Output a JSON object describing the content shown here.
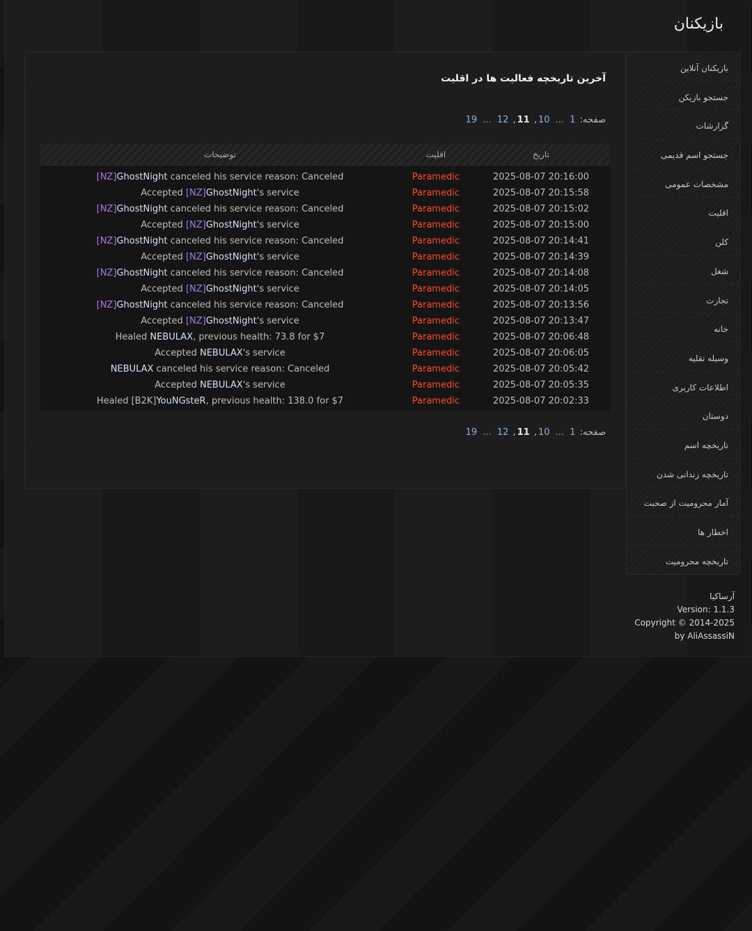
{
  "header": {
    "title": "بازیکنان"
  },
  "panel": {
    "title": "آخرین تاریخچه فعالیت ها در اقلیت"
  },
  "pagination": {
    "label": "صفحه:",
    "pages": [
      "1",
      "10",
      "11",
      "12",
      "19"
    ],
    "ellipsis": "...",
    "current": "11"
  },
  "table": {
    "headers": {
      "description": "توضیحات",
      "minority": "اقلیت",
      "date": "تاریخ"
    },
    "rows": [
      {
        "parts": [
          {
            "t": "[NZ]",
            "k": "tag"
          },
          {
            "t": "GhostNight",
            "k": "name"
          },
          {
            "t": " canceled his service reason: Canceled",
            "k": "plain"
          }
        ],
        "minority": "Paramedic",
        "date": "2025-08-07 20:16:00"
      },
      {
        "parts": [
          {
            "t": "Accepted ",
            "k": "plain"
          },
          {
            "t": "[NZ]",
            "k": "tag"
          },
          {
            "t": "GhostNight",
            "k": "name"
          },
          {
            "t": "'s service",
            "k": "plain"
          }
        ],
        "minority": "Paramedic",
        "date": "2025-08-07 20:15:58"
      },
      {
        "parts": [
          {
            "t": "[NZ]",
            "k": "tag"
          },
          {
            "t": "GhostNight",
            "k": "name"
          },
          {
            "t": " canceled his service reason: Canceled",
            "k": "plain"
          }
        ],
        "minority": "Paramedic",
        "date": "2025-08-07 20:15:02"
      },
      {
        "parts": [
          {
            "t": "Accepted ",
            "k": "plain"
          },
          {
            "t": "[NZ]",
            "k": "tag"
          },
          {
            "t": "GhostNight",
            "k": "name"
          },
          {
            "t": "'s service",
            "k": "plain"
          }
        ],
        "minority": "Paramedic",
        "date": "2025-08-07 20:15:00"
      },
      {
        "parts": [
          {
            "t": "[NZ]",
            "k": "tag"
          },
          {
            "t": "GhostNight",
            "k": "name"
          },
          {
            "t": " canceled his service reason: Canceled",
            "k": "plain"
          }
        ],
        "minority": "Paramedic",
        "date": "2025-08-07 20:14:41"
      },
      {
        "parts": [
          {
            "t": "Accepted ",
            "k": "plain"
          },
          {
            "t": "[NZ]",
            "k": "tag"
          },
          {
            "t": "GhostNight",
            "k": "name"
          },
          {
            "t": "'s service",
            "k": "plain"
          }
        ],
        "minority": "Paramedic",
        "date": "2025-08-07 20:14:39"
      },
      {
        "parts": [
          {
            "t": "[NZ]",
            "k": "tag"
          },
          {
            "t": "GhostNight",
            "k": "name"
          },
          {
            "t": " canceled his service reason: Canceled",
            "k": "plain"
          }
        ],
        "minority": "Paramedic",
        "date": "2025-08-07 20:14:08"
      },
      {
        "parts": [
          {
            "t": "Accepted ",
            "k": "plain"
          },
          {
            "t": "[NZ]",
            "k": "tag"
          },
          {
            "t": "GhostNight",
            "k": "name"
          },
          {
            "t": "'s service",
            "k": "plain"
          }
        ],
        "minority": "Paramedic",
        "date": "2025-08-07 20:14:05"
      },
      {
        "parts": [
          {
            "t": "[NZ]",
            "k": "tag"
          },
          {
            "t": "GhostNight",
            "k": "name"
          },
          {
            "t": " canceled his service reason: Canceled",
            "k": "plain"
          }
        ],
        "minority": "Paramedic",
        "date": "2025-08-07 20:13:56"
      },
      {
        "parts": [
          {
            "t": "Accepted ",
            "k": "plain"
          },
          {
            "t": "[NZ]",
            "k": "tag"
          },
          {
            "t": "GhostNight",
            "k": "name"
          },
          {
            "t": "'s service",
            "k": "plain"
          }
        ],
        "minority": "Paramedic",
        "date": "2025-08-07 20:13:47"
      },
      {
        "parts": [
          {
            "t": "Healed ",
            "k": "plain"
          },
          {
            "t": "NEBULAX",
            "k": "name"
          },
          {
            "t": ", previous health: 73.8 for $7",
            "k": "plain"
          }
        ],
        "minority": "Paramedic",
        "date": "2025-08-07 20:06:48"
      },
      {
        "parts": [
          {
            "t": "Accepted ",
            "k": "plain"
          },
          {
            "t": "NEBULAX",
            "k": "name"
          },
          {
            "t": "'s service",
            "k": "plain"
          }
        ],
        "minority": "Paramedic",
        "date": "2025-08-07 20:06:05"
      },
      {
        "parts": [
          {
            "t": "NEBULAX",
            "k": "name"
          },
          {
            "t": " canceled his service reason: Canceled",
            "k": "plain"
          }
        ],
        "minority": "Paramedic",
        "date": "2025-08-07 20:05:42"
      },
      {
        "parts": [
          {
            "t": "Accepted ",
            "k": "plain"
          },
          {
            "t": "NEBULAX",
            "k": "name"
          },
          {
            "t": "'s service",
            "k": "plain"
          }
        ],
        "minority": "Paramedic",
        "date": "2025-08-07 20:05:35"
      },
      {
        "parts": [
          {
            "t": "Healed [B2K]",
            "k": "plain"
          },
          {
            "t": "YouNGsteR",
            "k": "name"
          },
          {
            "t": ", previous health: 138.0 for $7",
            "k": "plain"
          }
        ],
        "minority": "Paramedic",
        "date": "2025-08-07 20:02:33"
      }
    ]
  },
  "sidebar": {
    "items": [
      "بازیکنان آنلاین",
      "جستجو بازیکن",
      "گزارشات",
      "جستجو اسم قدیمی",
      "مشخصات عمومی",
      "اقلیت",
      "کلن",
      "شغل",
      "تجارت",
      "خانه",
      "وسیله نقلیه",
      "اطلاعات کاربری",
      "دوستان",
      "تاریخچه اسم",
      "تاریخچه زندانی شدن",
      "آمار محرومیت از صحبت",
      "اخطار ها",
      "تاریخچه محرومیت"
    ]
  },
  "footer": {
    "brand": "آرساکیا",
    "version": "Version: 1.1.3",
    "copyright": "Copyright © 2014-2025",
    "author": "by AliAssassiN"
  },
  "colors": {
    "minority": "#ff4a2a",
    "tag": "#a779e8",
    "name": "#d0e2f5",
    "link": "#8fb3d9"
  }
}
